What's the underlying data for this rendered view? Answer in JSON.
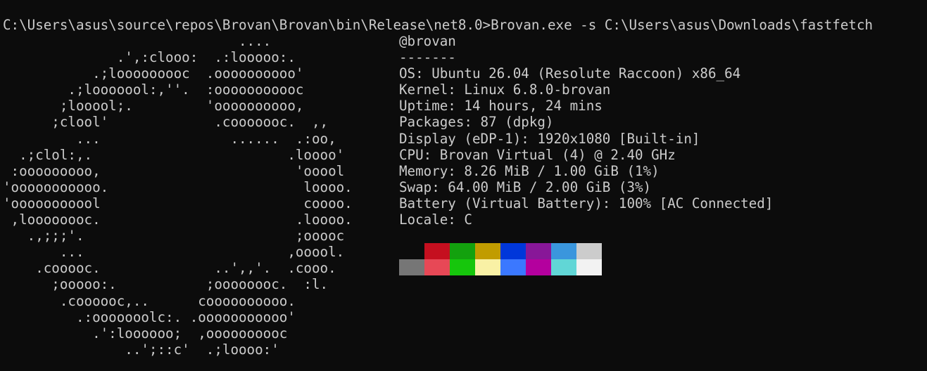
{
  "terminal": {
    "command_line": "C:\\Users\\asus\\source\\repos\\Brovan\\Brovan\\bin\\Release\\net8.0>Brovan.exe -s C:\\Users\\asus\\Downloads\\fastfetch",
    "logo_lines": [
      "                             ....",
      "              .',:clooo:  .:looooo:.",
      "           .;looooooooc  .oooooooooo'",
      "        .;looooool:,''.  :ooooooooooc",
      "       ;looool;.         'oooooooooo,",
      "      ;clool'             .cooooooc.  ,,",
      "         ...                ......  .:oo,",
      "  .;clol:,.                        .loooo'",
      " :ooooooooo,                        'ooool",
      "'ooooooooooo.                        loooo.",
      "'ooooooooool                         coooo.",
      " ,loooooooc.                        .loooo.",
      "   .,;;;'.                          ;ooooc",
      "       ...                         ,ooool.",
      "    .cooooc.              ..',,'.  .cooo.",
      "      ;ooooo:.           ;oooooooc.  :l.",
      "       .coooooc,..      coooooooooo.",
      "         .:ooooooolc:. .ooooooooooo'",
      "           .':loooooo;  ,oooooooooc",
      "               ..';::c'  .;loooo:'"
    ],
    "info": {
      "user_host": "@brovan",
      "separator": "-------",
      "lines": [
        "OS: Ubuntu 26.04 (Resolute Raccoon) x86_64",
        "Kernel: Linux 6.8.0-brovan",
        "Uptime: 14 hours, 24 mins",
        "Packages: 87 (dpkg)",
        "Display (eDP-1): 1920x1080 [Built-in]",
        "CPU: Brovan Virtual (4) @ 2.40 GHz",
        "Memory: 8.26 MiB / 1.00 GiB (1%)",
        "Swap: 64.00 MiB / 2.00 GiB (3%)",
        "Battery (Virtual Battery): 100% [AC Connected]",
        "Locale: C"
      ]
    },
    "palette": {
      "normal": [
        "#0c0c0c",
        "#c50f1f",
        "#13a10e",
        "#c19c00",
        "#0037da",
        "#881798",
        "#3a96dd",
        "#cccccc"
      ],
      "bright": [
        "#767676",
        "#e74856",
        "#16c60c",
        "#f9f1a5",
        "#3b78ff",
        "#b4009e",
        "#61d6d6",
        "#f2f2f2"
      ]
    },
    "colors": {
      "background": "#0c0c0c",
      "foreground": "#cccccc"
    }
  }
}
